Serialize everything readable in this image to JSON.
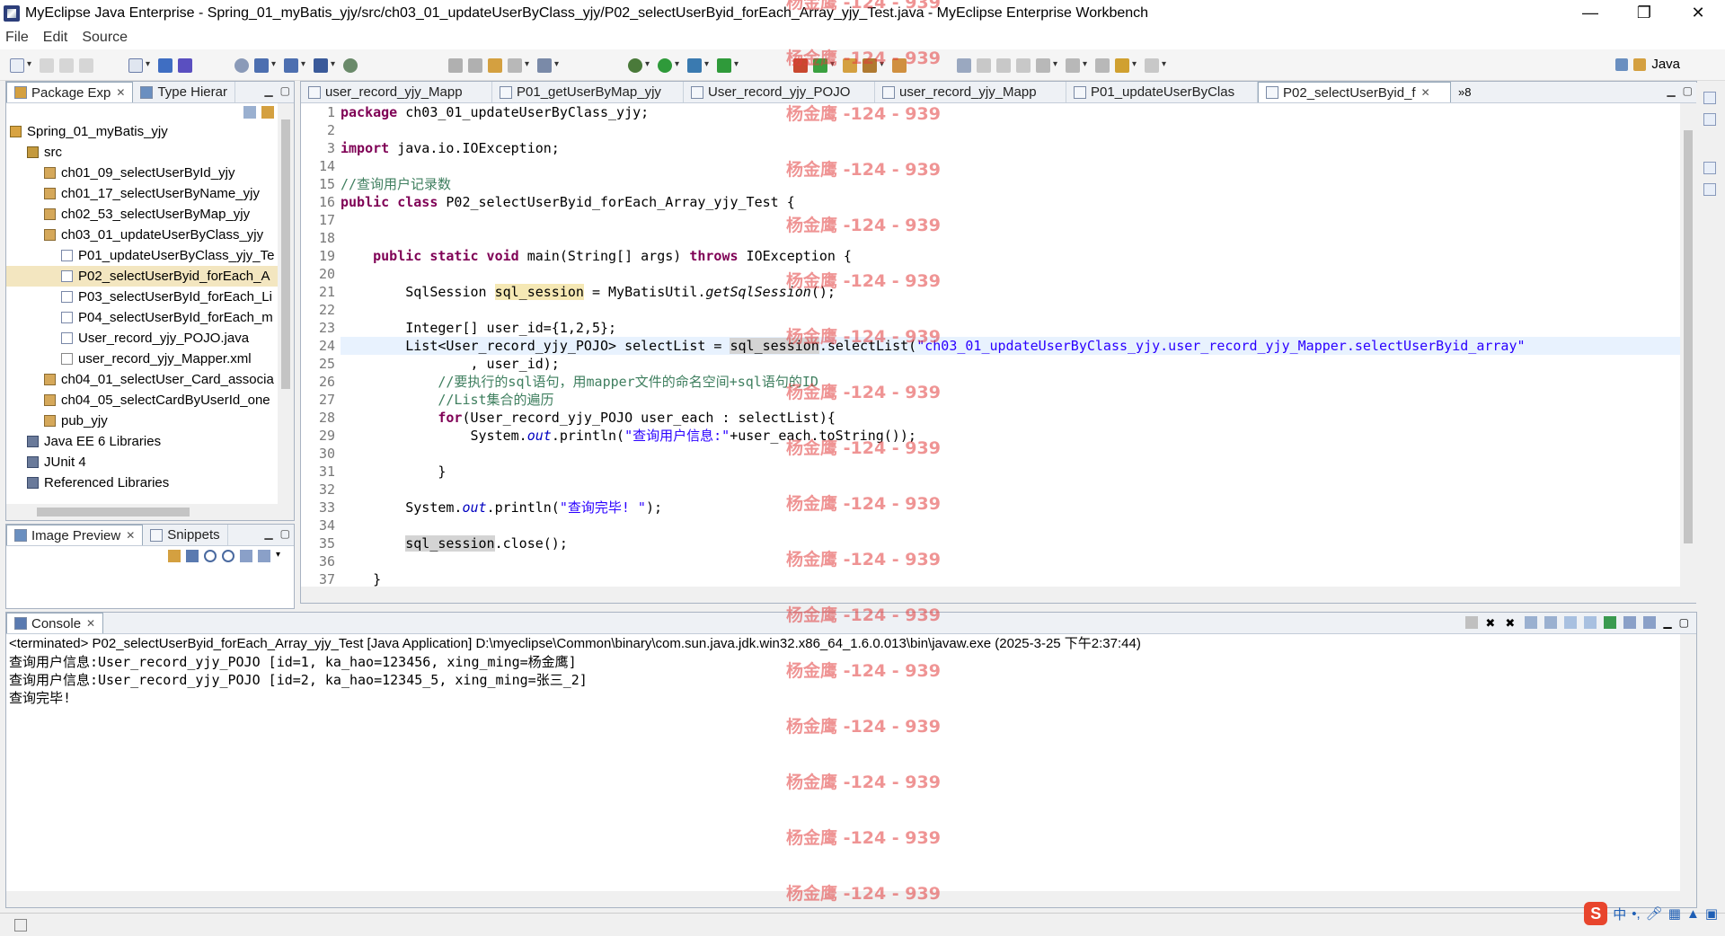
{
  "window": {
    "title": "MyEclipse Java Enterprise - Spring_01_myBatis_yjy/src/ch03_01_updateUserByClass_yjy/P02_selectUserByid_forEach_Array_yjy_Test.java - MyEclipse Enterprise Workbench",
    "minimize": "—",
    "restore": "❐",
    "close": "✕"
  },
  "menu": [
    "File",
    "Edit",
    "Source"
  ],
  "perspective": {
    "label": "Java"
  },
  "package_explorer": {
    "tabs": [
      {
        "label": "Package Exp",
        "close": "✕"
      },
      {
        "label": "Type Hierar"
      }
    ],
    "tree": [
      {
        "label": "Spring_01_myBatis_yjy",
        "icon": "project-icon",
        "indent": 0
      },
      {
        "label": "src",
        "icon": "source-folder-icon",
        "indent": 1
      },
      {
        "label": "ch01_09_selectUserById_yjy",
        "icon": "package-icon",
        "indent": 2
      },
      {
        "label": "ch01_17_selectUserByName_yjy",
        "icon": "package-icon",
        "indent": 2
      },
      {
        "label": "ch02_53_selectUserByMap_yjy",
        "icon": "package-icon",
        "indent": 2
      },
      {
        "label": "ch03_01_updateUserByClass_yjy",
        "icon": "package-icon",
        "indent": 2
      },
      {
        "label": "P01_updateUserByClass_yjy_Te",
        "icon": "java-file-icon",
        "indent": 3
      },
      {
        "label": "P02_selectUserByid_forEach_A",
        "icon": "java-file-icon",
        "indent": 3,
        "selected": true
      },
      {
        "label": "P03_selectUserById_forEach_Li",
        "icon": "java-file-icon",
        "indent": 3
      },
      {
        "label": "P04_selectUserById_forEach_m",
        "icon": "java-file-icon",
        "indent": 3
      },
      {
        "label": "User_record_yjy_POJO.java",
        "icon": "java-file-icon",
        "indent": 3
      },
      {
        "label": "user_record_yjy_Mapper.xml",
        "icon": "xml-file-icon",
        "indent": 3
      },
      {
        "label": "ch04_01_selectUser_Card_associa",
        "icon": "package-icon",
        "indent": 2
      },
      {
        "label": "ch04_05_selectCardByUserId_one",
        "icon": "package-icon",
        "indent": 2
      },
      {
        "label": "pub_yjy",
        "icon": "package-icon",
        "indent": 2
      },
      {
        "label": "Java EE 6 Libraries",
        "icon": "library-icon",
        "indent": 1
      },
      {
        "label": "JUnit 4",
        "icon": "library-icon",
        "indent": 1
      },
      {
        "label": "Referenced Libraries",
        "icon": "library-icon",
        "indent": 1
      }
    ]
  },
  "image_preview": {
    "tabs": [
      {
        "label": "Image Preview",
        "close": "✕"
      },
      {
        "label": "Snippets"
      }
    ]
  },
  "editor": {
    "tabs": [
      {
        "label": "user_record_yjy_Mapp"
      },
      {
        "label": "P01_getUserByMap_yjy"
      },
      {
        "label": "User_record_yjy_POJO"
      },
      {
        "label": "user_record_yjy_Mapp"
      },
      {
        "label": "P01_updateUserByClas"
      },
      {
        "label": "P02_selectUserByid_f",
        "active": true,
        "close": "✕"
      }
    ],
    "overflow": "»8",
    "line_numbers": [
      "1",
      "2",
      "3",
      "14",
      "15",
      "16",
      "17",
      "18",
      "19",
      "20",
      "21",
      "22",
      "23",
      "24",
      "25",
      "26",
      "27",
      "28",
      "29",
      "30",
      "31",
      "32",
      "33",
      "34",
      "35",
      "36",
      "37"
    ],
    "lines": [
      "<span class=\"kw\">package</span> ch03_01_updateUserByClass_yjy;",
      "",
      "<span class=\"kw\">import</span> java.io.IOException;",
      "",
      "<span class=\"cm\">//查询用户记录数</span>",
      "<span class=\"kw\">public class</span> P02_selectUserByid_forEach_Array_yjy_Test {",
      "",
      "",
      "    <span class=\"kw\">public static void</span> main(String[] args) <span class=\"kw\">throws</span> IOException {",
      "",
      "        SqlSession <span class=\"occw\">sql_session</span> = MyBatisUtil.<span class=\"ital\">getSqlSession</span>();",
      "",
      "        Integer[] user_id={1,2,5};",
      "        List&lt;User_record_yjy_POJO&gt; selectList = <span class=\"occ\">sql_session</span>.selectList(<span class=\"st\">\"ch03_01_updateUserByClass_yjy.user_record_yjy_Mapper.selectUserByid_array\"</span>",
      "                , user_id);",
      "            <span class=\"cm\">//要执行的sql语句，用mapper文件的命名空间+sql语句的ID</span>",
      "            <span class=\"cm\">//List集合的遍历</span>",
      "            <span class=\"kw\">for</span>(User_record_yjy_POJO user_each : selectList){",
      "                System.<span class=\"fld\">out</span>.println(<span class=\"st\">\"查询用户信息:\"</span>+user_each.toString());",
      "",
      "            }",
      "",
      "        System.<span class=\"fld\">out</span>.println(<span class=\"st\">\"查询完毕! \"</span>);",
      "",
      "        <span class=\"occ\">sql_session</span>.close();",
      "",
      "    }"
    ],
    "highlight_line_index": 13
  },
  "console": {
    "tab_label": "Console",
    "close": "✕",
    "header": "<terminated> P02_selectUserByid_forEach_Array_yjy_Test [Java Application] D:\\myeclipse\\Common\\binary\\com.sun.java.jdk.win32.x86_64_1.6.0.013\\bin\\javaw.exe (2025-3-25 下午2:37:44)",
    "output": [
      "查询用户信息:User_record_yjy_POJO [id=1, ka_hao=123456, xing_ming=杨金鹰]",
      "查询用户信息:User_record_yjy_POJO [id=2, ka_hao=12345_5, xing_ming=张三_2]",
      "查询完毕!"
    ]
  },
  "watermark": {
    "text": "杨金鹰 -124 - 939",
    "color": "#e13c3c"
  },
  "ime": {
    "logo": "S",
    "label": "中"
  }
}
